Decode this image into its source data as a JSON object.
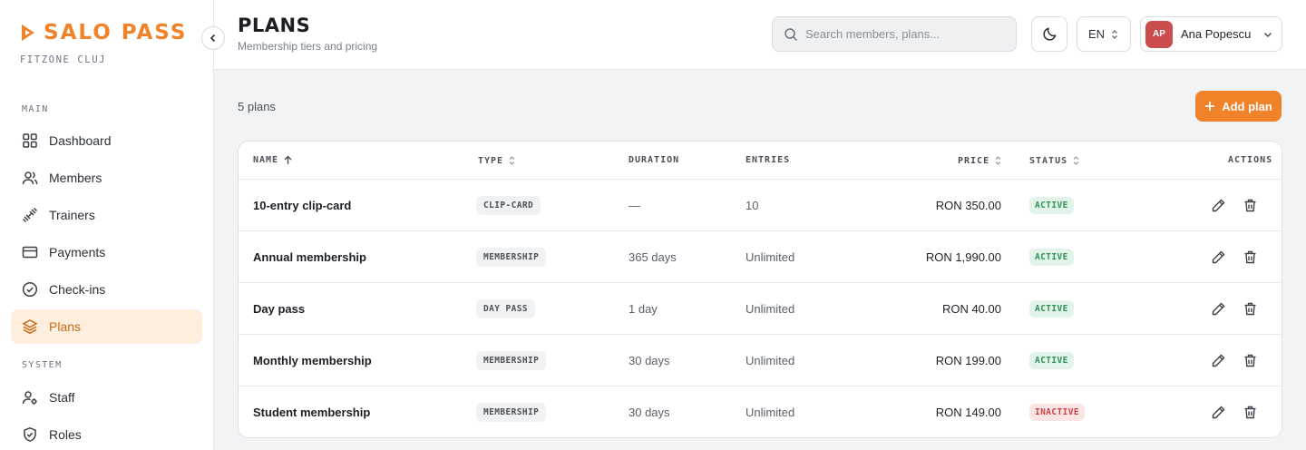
{
  "brand": {
    "name": "SALO PASS",
    "club": "FITZONE CLUJ",
    "accent": "#f0822a"
  },
  "sidebar": {
    "sections": [
      {
        "label": "MAIN"
      },
      {
        "label": "SYSTEM"
      }
    ],
    "items": [
      {
        "label": "Dashboard",
        "icon": "grid-icon"
      },
      {
        "label": "Members",
        "icon": "users-icon"
      },
      {
        "label": "Trainers",
        "icon": "dumbbell-icon"
      },
      {
        "label": "Payments",
        "icon": "card-icon"
      },
      {
        "label": "Check-ins",
        "icon": "check-circle-icon"
      },
      {
        "label": "Plans",
        "icon": "layers-icon",
        "active": true
      },
      {
        "label": "Staff",
        "icon": "user-gear-icon"
      },
      {
        "label": "Roles",
        "icon": "shield-icon"
      }
    ]
  },
  "header": {
    "title": "PLANS",
    "subtitle": "Membership tiers and pricing",
    "search_placeholder": "Search members, plans...",
    "language": "EN",
    "user": {
      "initials": "AP",
      "name": "Ana Popescu"
    }
  },
  "content": {
    "plan_count": "5 plans",
    "add_label": "Add plan"
  },
  "table": {
    "columns": {
      "name": "NAME",
      "type": "TYPE",
      "duration": "DURATION",
      "entries": "ENTRIES",
      "price": "PRICE",
      "status": "STATUS",
      "actions": "ACTIONS"
    },
    "rows": [
      {
        "name": "10-entry clip-card",
        "type": "CLIP-CARD",
        "duration": "—",
        "entries": "10",
        "price": "RON 350.00",
        "status": "ACTIVE"
      },
      {
        "name": "Annual membership",
        "type": "MEMBERSHIP",
        "duration": "365 days",
        "entries": "Unlimited",
        "price": "RON 1,990.00",
        "status": "ACTIVE"
      },
      {
        "name": "Day pass",
        "type": "DAY PASS",
        "duration": "1 day",
        "entries": "Unlimited",
        "price": "RON 40.00",
        "status": "ACTIVE"
      },
      {
        "name": "Monthly membership",
        "type": "MEMBERSHIP",
        "duration": "30 days",
        "entries": "Unlimited",
        "price": "RON 199.00",
        "status": "ACTIVE"
      },
      {
        "name": "Student membership",
        "type": "MEMBERSHIP",
        "duration": "30 days",
        "entries": "Unlimited",
        "price": "RON 149.00",
        "status": "INACTIVE"
      }
    ]
  }
}
